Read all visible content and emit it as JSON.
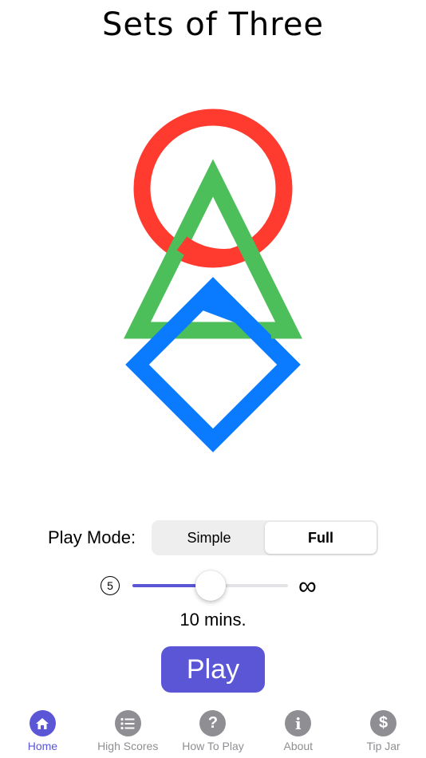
{
  "title": "Sets of Three",
  "colors": {
    "accent": "#5a56d6",
    "red": "#ff3b30",
    "green": "#4cbe5a",
    "blue": "#0a7bff",
    "tab_inactive": "#8e8e93"
  },
  "play_mode": {
    "label": "Play Mode:",
    "options": [
      "Simple",
      "Full"
    ],
    "selected": "Full"
  },
  "time_slider": {
    "min_label": "5",
    "max_label": "∞",
    "value_fraction": 0.5
  },
  "duration_text": "10 mins.",
  "play_button": "Play",
  "tabs": [
    {
      "label": "Home",
      "icon": "house-icon",
      "active": true
    },
    {
      "label": "High Scores",
      "icon": "list-icon",
      "active": false
    },
    {
      "label": "How To Play",
      "icon": "question-icon",
      "active": false
    },
    {
      "label": "About",
      "icon": "info-icon",
      "active": false
    },
    {
      "label": "Tip Jar",
      "icon": "dollar-icon",
      "active": false
    }
  ]
}
